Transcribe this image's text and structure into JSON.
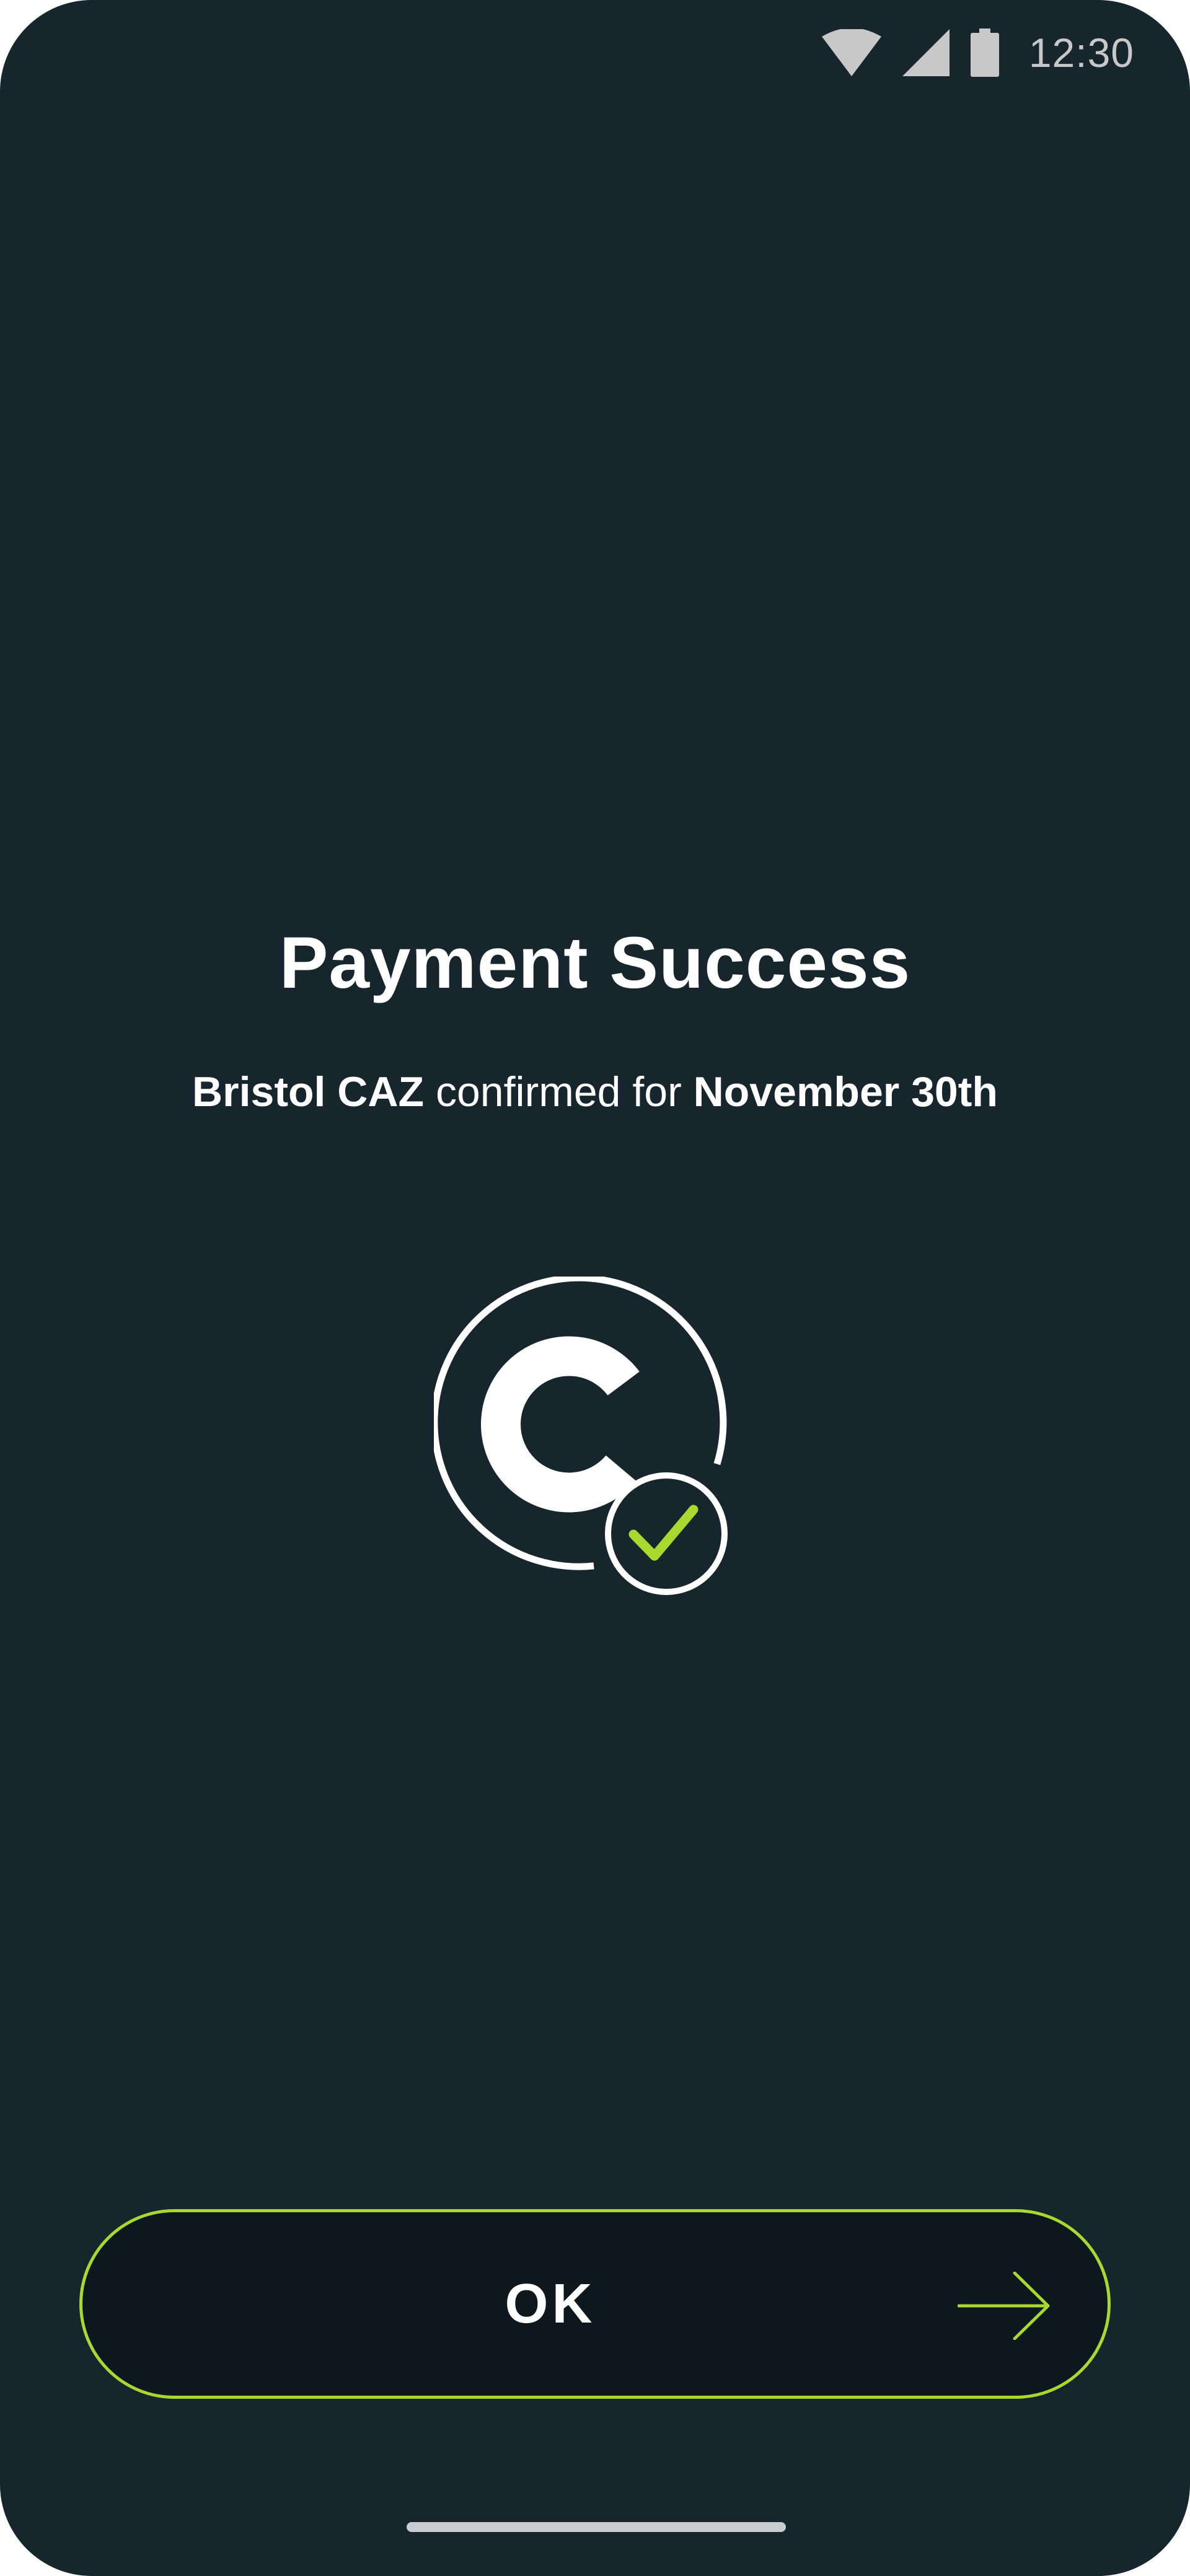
{
  "status_bar": {
    "time": "12:30",
    "icons": [
      "wifi-icon",
      "cellular-signal-icon",
      "battery-icon"
    ]
  },
  "payment": {
    "title": "Payment Success",
    "zone": "Bristol CAZ",
    "connector": " confirmed for ",
    "date": "November 30th"
  },
  "illustration": {
    "icons": [
      "logo-c-icon",
      "checkmark-icon"
    ]
  },
  "ok_button": {
    "label": "OK",
    "icon": "arrow-right-icon"
  },
  "colors": {
    "background": "#17252c",
    "accent": "#a9d82e",
    "button_fill": "#0c171e",
    "text": "#ffffff"
  }
}
